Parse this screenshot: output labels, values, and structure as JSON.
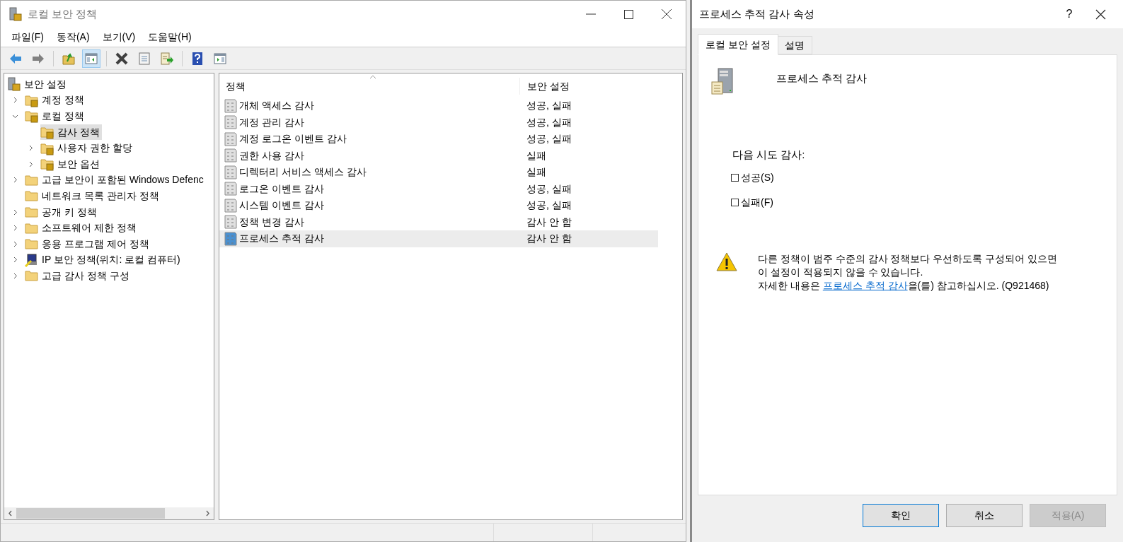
{
  "main_window": {
    "title": "로컬 보안 정책",
    "menu": [
      "파일(F)",
      "동작(A)",
      "보기(V)",
      "도움말(H)"
    ],
    "toolbar": [
      {
        "kind": "back",
        "pressed": false
      },
      {
        "kind": "forward",
        "pressed": false
      },
      {
        "kind": "separator"
      },
      {
        "kind": "up",
        "pressed": false
      },
      {
        "kind": "tree-pane",
        "pressed": true
      },
      {
        "kind": "separator"
      },
      {
        "kind": "delete",
        "pressed": false
      },
      {
        "kind": "properties",
        "pressed": false
      },
      {
        "kind": "export",
        "pressed": false
      },
      {
        "kind": "separator"
      },
      {
        "kind": "help",
        "pressed": false
      },
      {
        "kind": "action-pane",
        "pressed": false
      }
    ],
    "tree": [
      {
        "label": "보안 설정",
        "kind": "server",
        "selected": false,
        "children": [
          {
            "label": "계정 정책",
            "kind": "lock-folder",
            "expanded": false,
            "selected": false
          },
          {
            "label": "로컬 정책",
            "kind": "lock-folder",
            "expanded": true,
            "selected": false,
            "children": [
              {
                "label": "감사 정책",
                "kind": "lock-folder",
                "selected": true
              },
              {
                "label": "사용자 권한 할당",
                "kind": "lock-folder",
                "expanded": false,
                "selected": false
              },
              {
                "label": "보안 옵션",
                "kind": "lock-folder",
                "expanded": false,
                "selected": false
              }
            ]
          },
          {
            "label": "고급 보안이 포함된 Windows Defenc",
            "kind": "folder",
            "expanded": false,
            "selected": false
          },
          {
            "label": "네트워크 목록 관리자 정책",
            "kind": "folder",
            "selected": false
          },
          {
            "label": "공개 키 정책",
            "kind": "folder",
            "expanded": false,
            "selected": false
          },
          {
            "label": "소프트웨어 제한 정책",
            "kind": "folder",
            "expanded": false,
            "selected": false
          },
          {
            "label": "응용 프로그램 제어 정책",
            "kind": "folder",
            "expanded": false,
            "selected": false
          },
          {
            "label": "IP 보안 정책(위치: 로컬 컴퓨터)",
            "kind": "ip-security",
            "expanded": false,
            "selected": false
          },
          {
            "label": "고급 감사 정책 구성",
            "kind": "folder",
            "expanded": false,
            "selected": false
          }
        ]
      }
    ],
    "table": {
      "columns": [
        "정책",
        "보안 설정"
      ],
      "rows": [
        {
          "policy": "개체 액세스 감사",
          "setting": "성공, 실패",
          "selected": false
        },
        {
          "policy": "계정 관리 감사",
          "setting": "성공, 실패",
          "selected": false
        },
        {
          "policy": "계정 로그온 이벤트 감사",
          "setting": "성공, 실패",
          "selected": false
        },
        {
          "policy": "권한 사용 감사",
          "setting": "실패",
          "selected": false
        },
        {
          "policy": "디렉터리 서비스 액세스 감사",
          "setting": "실패",
          "selected": false
        },
        {
          "policy": "로그온 이벤트 감사",
          "setting": "성공, 실패",
          "selected": false
        },
        {
          "policy": "시스템 이벤트 감사",
          "setting": "성공, 실패",
          "selected": false
        },
        {
          "policy": "정책 변경 감사",
          "setting": "감사 안 함",
          "selected": false
        },
        {
          "policy": "프로세스 추적 감사",
          "setting": "감사 안 함",
          "selected": true
        }
      ]
    }
  },
  "dialog": {
    "title": "프로세스 추적 감사 속성",
    "help": "?",
    "tabs": [
      {
        "label": "로컬 보안 설정",
        "selected": true
      },
      {
        "label": "설명",
        "selected": false
      }
    ],
    "policy_name": "프로세스 추적 감사",
    "prompt": "다음 시도 감사:",
    "options": [
      {
        "label": "성공(S)",
        "checked": false
      },
      {
        "label": "실패(F)",
        "checked": false
      }
    ],
    "warning": {
      "lines": [
        "다른 정책이 범주 수준의 감사 정책보다 우선하도록 구성되어 있으면",
        "이 설정이 적용되지 않을 수 있습니다."
      ],
      "prefix": "자세한 내용은 ",
      "link": "프로세스 추적 감사",
      "suffix": "을(를) 참고하십시오. (Q921468)"
    },
    "buttons": [
      {
        "label": "확인",
        "default": true,
        "disabled": false
      },
      {
        "label": "취소",
        "default": false,
        "disabled": false
      },
      {
        "label": "적용(A)",
        "default": false,
        "disabled": true
      }
    ]
  }
}
